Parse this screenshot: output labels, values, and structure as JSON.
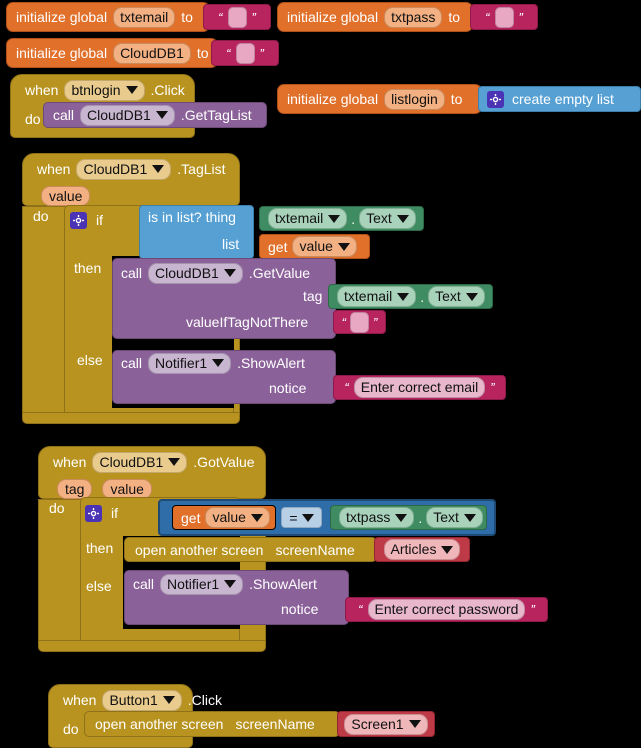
{
  "app": {
    "editor": "MIT App Inventor Blocks Editor",
    "background": "#000000"
  },
  "palette": {
    "variable": "#E0702A",
    "control": "#B8931F",
    "text": "#B8245E",
    "procedure_call": "#8B6199",
    "list": "#56A0D3",
    "logic_selected": "#2E6DA8",
    "component": "#3F8C62",
    "screen_name": "#BE3A46",
    "mutator_gear": "#4A33B5"
  },
  "blocks": {
    "init_txtemail": {
      "keyword": "initialize global",
      "name": "txtemail",
      "to": "to",
      "value_kind": "empty-text-string"
    },
    "init_txtpass": {
      "keyword": "initialize global",
      "name": "txtpass",
      "to": "to",
      "value_kind": "empty-text-string"
    },
    "init_clouddb1": {
      "keyword": "initialize global",
      "name": "CloudDB1",
      "to": "to",
      "value_kind": "empty-text-string"
    },
    "init_listlogin": {
      "keyword": "initialize global",
      "name": "listlogin",
      "to": "to",
      "value_label": "create empty list"
    },
    "btnlogin_click": {
      "when": "when",
      "component": "btnlogin",
      "event": ".Click",
      "do": "do",
      "call": "call",
      "call_component": "CloudDB1",
      "call_method": ".GetTagList"
    },
    "clouddb1_taglist": {
      "when": "when",
      "component": "CloudDB1",
      "event": ".TagList",
      "params": [
        "value"
      ],
      "do": "do",
      "if": "if",
      "then": "then",
      "else": "else",
      "condition": {
        "block": "is in list? thing",
        "thing_component": "txtemail",
        "thing_property": "Text",
        "list_label": "list",
        "list_get": "get",
        "list_var": "value"
      },
      "then_stmt": {
        "call": "call",
        "component": "CloudDB1",
        "method": ".GetValue",
        "arg1_label": "tag",
        "arg1_component": "txtemail",
        "arg1_property": "Text",
        "arg2_label": "valueIfTagNotThere",
        "arg2_kind": "empty-text-string"
      },
      "else_stmt": {
        "call": "call",
        "component": "Notifier1",
        "method": ".ShowAlert",
        "arg1_label": "notice",
        "arg1_text": "Enter correct email"
      }
    },
    "clouddb1_gotvalue": {
      "when": "when",
      "component": "CloudDB1",
      "event": ".GotValue",
      "params": [
        "tag",
        "value"
      ],
      "do": "do",
      "if": "if",
      "then": "then",
      "else": "else",
      "condition": {
        "left_get": "get",
        "left_var": "value",
        "operator": "=",
        "right_component": "txtpass",
        "right_property": "Text"
      },
      "then_stmt": {
        "label": "open another screen",
        "arg_label": "screenName",
        "screen": "Articles"
      },
      "else_stmt": {
        "call": "call",
        "component": "Notifier1",
        "method": ".ShowAlert",
        "arg1_label": "notice",
        "arg1_text": "Enter correct password"
      }
    },
    "button1_click": {
      "when": "when",
      "component": "Button1",
      "event": ".Click",
      "do": "do",
      "stmt": {
        "label": "open another screen",
        "arg_label": "screenName",
        "screen": "Screen1"
      }
    }
  }
}
